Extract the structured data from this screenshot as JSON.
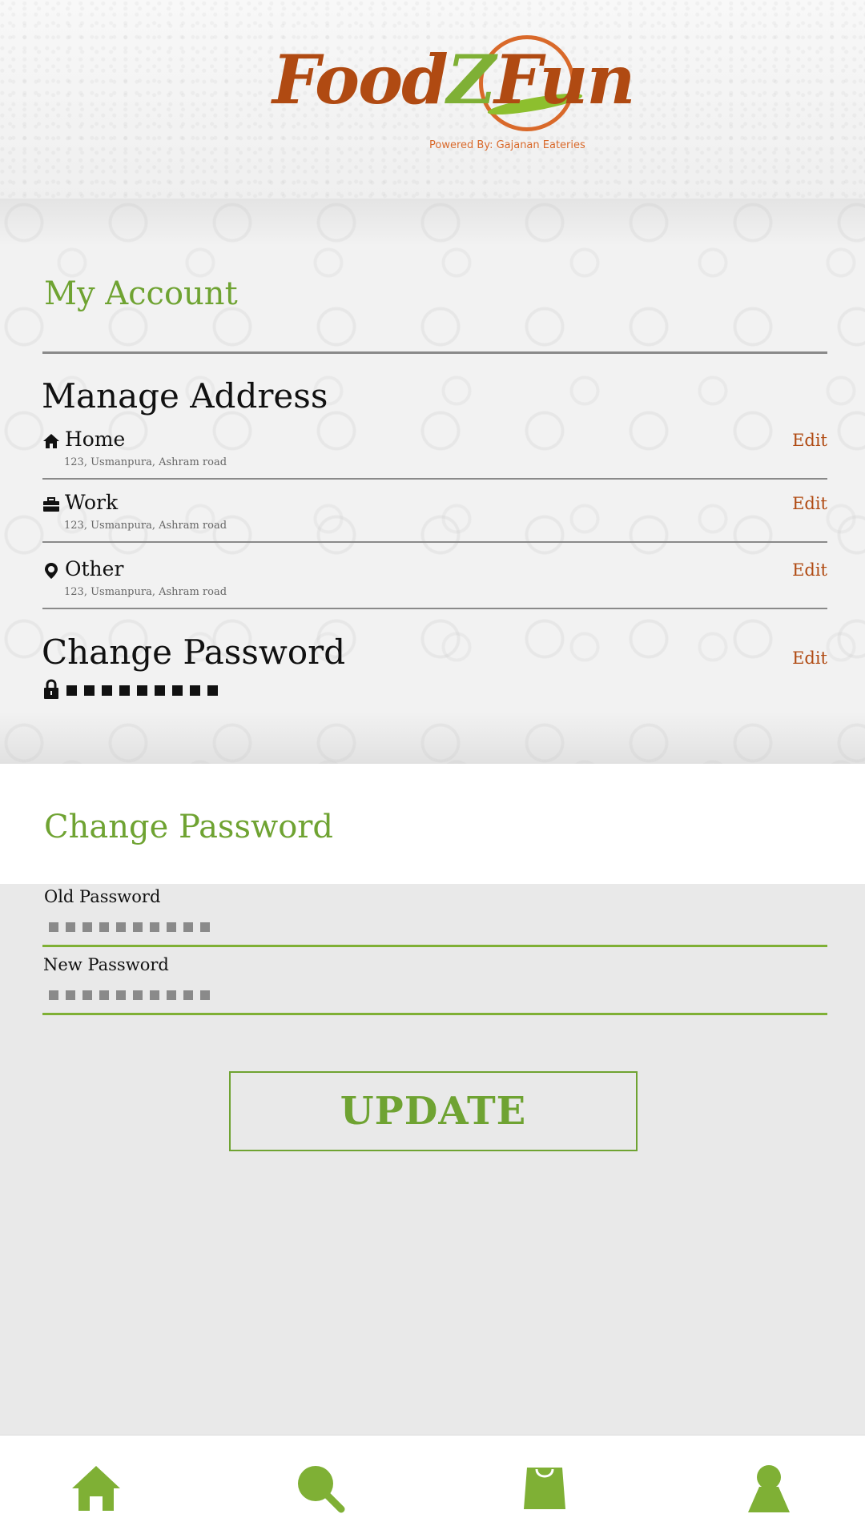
{
  "brand": {
    "logo_text_1": "Food",
    "logo_text_z": "Z",
    "logo_text_2": "Fun",
    "tagline": "Powered By: Gajanan Eateries"
  },
  "account": {
    "title": "My Account",
    "manage_address_title": "Manage Address",
    "addresses": [
      {
        "icon": "home-icon",
        "label": "Home",
        "address": "123, Usmanpura, Ashram road",
        "edit": "Edit"
      },
      {
        "icon": "briefcase-icon",
        "label": "Work",
        "address": "123, Usmanpura, Ashram road",
        "edit": "Edit"
      },
      {
        "icon": "map-pin-icon",
        "label": "Other",
        "address": "123, Usmanpura, Ashram road",
        "edit": "Edit"
      }
    ],
    "change_password_title": "Change Password",
    "change_password_edit": "Edit",
    "password_mask_count": 9
  },
  "change_password_form": {
    "title": "Change Password",
    "old_password_label": "Old Password",
    "old_password_mask_count": 10,
    "new_password_label": "New Password",
    "new_password_mask_count": 10,
    "update_label": "UPDATE"
  },
  "bottom_nav": [
    {
      "icon": "home-icon"
    },
    {
      "icon": "search-icon"
    },
    {
      "icon": "shopping-bag-icon"
    },
    {
      "icon": "user-profile-icon"
    }
  ],
  "colors": {
    "accent_green": "#6fa332",
    "brand_brown": "#b04a12",
    "icon_green": "#7fb035"
  }
}
